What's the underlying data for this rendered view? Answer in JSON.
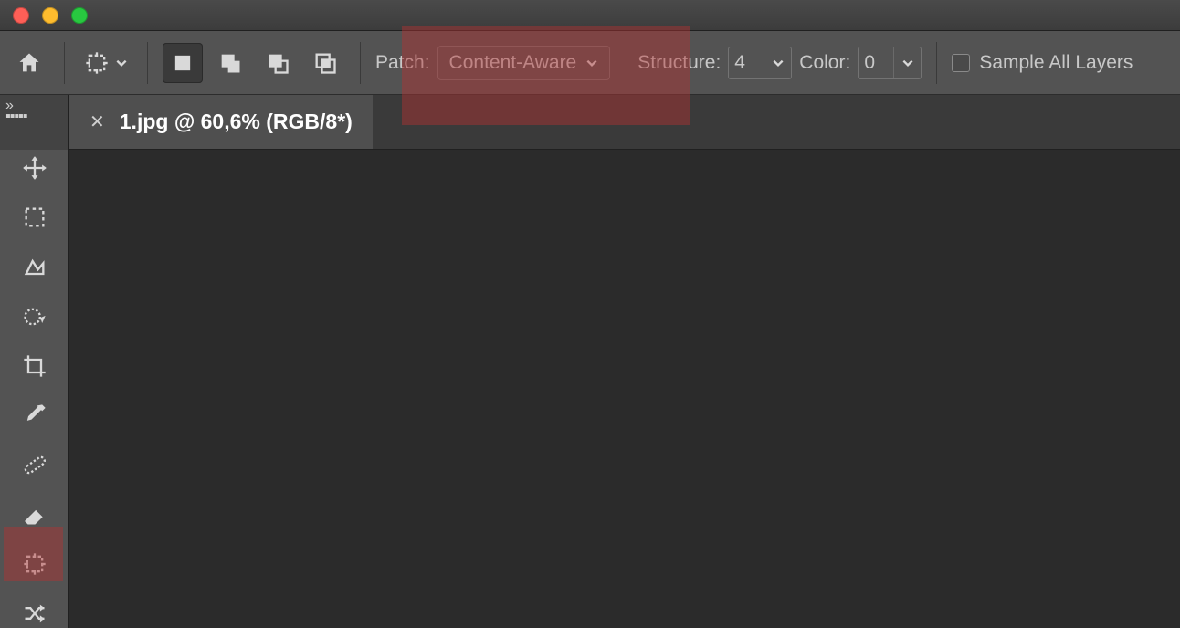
{
  "options": {
    "patch_label": "Patch:",
    "patch_value": "Content-Aware",
    "structure_label": "Structure:",
    "structure_value": "4",
    "color_label": "Color:",
    "color_value": "0",
    "sample_label": "Sample All Layers"
  },
  "document": {
    "tab_title": "1.jpg @ 60,6% (RGB/8*)"
  },
  "panel_toggle_glyph": "»"
}
